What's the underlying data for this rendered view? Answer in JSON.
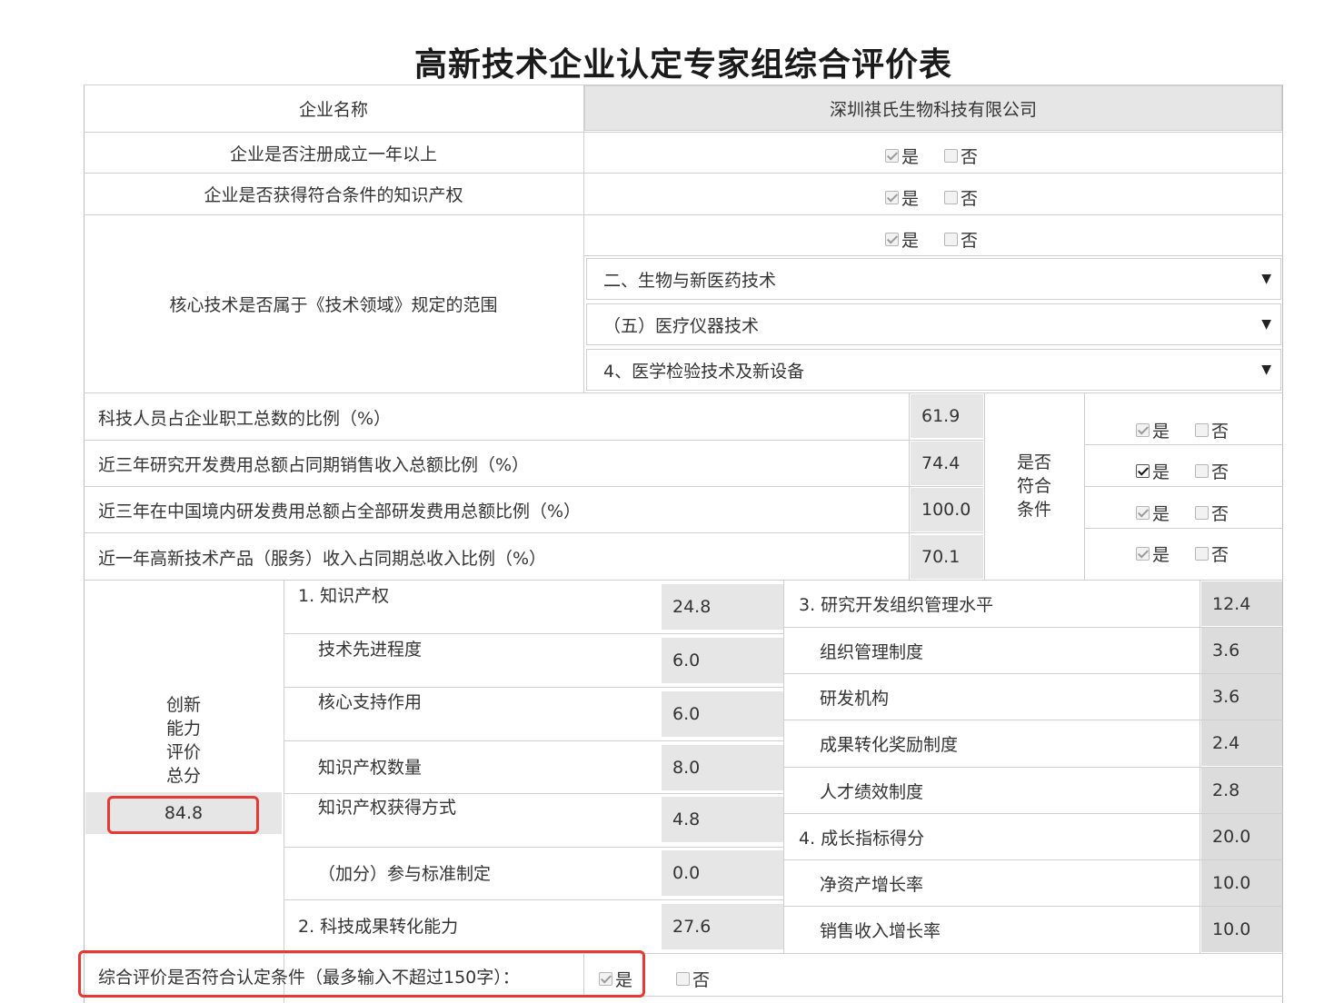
{
  "title": "高新技术企业认定专家组综合评价表",
  "company": {
    "label": "企业名称",
    "value": "深圳祺氏生物科技有限公司"
  },
  "yes": "是",
  "no": "否",
  "q1": {
    "label": "企业是否注册成立一年以上",
    "yes_checked": true,
    "no_checked": false
  },
  "q2": {
    "label": "企业是否获得符合条件的知识产权",
    "yes_checked": true,
    "no_checked": false
  },
  "q3": {
    "label": "核心技术是否属于《技术领域》规定的范围",
    "yes_checked": true,
    "no_checked": false,
    "select1": "二、生物与新医药技术",
    "select2": "（五）医疗仪器技术",
    "select3": "4、医学检验技术及新设备"
  },
  "ratios": {
    "group_label_1": "是否",
    "group_label_2": "符合",
    "group_label_3": "条件",
    "rows": [
      {
        "label": "科技人员占企业职工总数的比例（%）",
        "value": "61.9",
        "yes_checked": true
      },
      {
        "label": "近三年研究开发费用总额占同期销售收入总额比例（%）",
        "value": "74.4",
        "yes_checked": true
      },
      {
        "label": "近三年在中国境内研发费用总额占全部研发费用总额比例（%）",
        "value": "100.0",
        "yes_checked": true
      },
      {
        "label": "近一年高新技术产品（服务）收入占同期总收入比例（%）",
        "value": "70.1",
        "yes_checked": true
      }
    ]
  },
  "innovation": {
    "total_label_1": "创新",
    "total_label_2": "能力",
    "total_label_3": "评价",
    "total_label_4": "总分",
    "total_value": "84.8",
    "left": [
      {
        "label": "1. 知识产权",
        "value": "24.8"
      },
      {
        "label": "技术先进程度",
        "value": "6.0"
      },
      {
        "label": "核心支持作用",
        "value": "6.0"
      },
      {
        "label": "知识产权数量",
        "value": "8.0"
      },
      {
        "label": "知识产权获得方式",
        "value": "4.8"
      },
      {
        "label": "（加分）参与标准制定",
        "value": "0.0"
      },
      {
        "label": "2. 科技成果转化能力",
        "value": "27.6"
      }
    ],
    "right": [
      {
        "label": "3. 研究开发组织管理水平",
        "value": "12.4"
      },
      {
        "label": "组织管理制度",
        "value": "3.6"
      },
      {
        "label": "研发机构",
        "value": "3.6"
      },
      {
        "label": "成果转化奖励制度",
        "value": "2.4"
      },
      {
        "label": "人才绩效制度",
        "value": "2.8"
      },
      {
        "label": "4. 成长指标得分",
        "value": "20.0"
      },
      {
        "label": "净资产增长率",
        "value": "10.0"
      },
      {
        "label": "销售收入增长率",
        "value": "10.0"
      }
    ]
  },
  "overall": {
    "label": "综合评价是否符合认定条件（最多输入不超过150字）：",
    "yes_checked": true,
    "no_checked": false
  }
}
